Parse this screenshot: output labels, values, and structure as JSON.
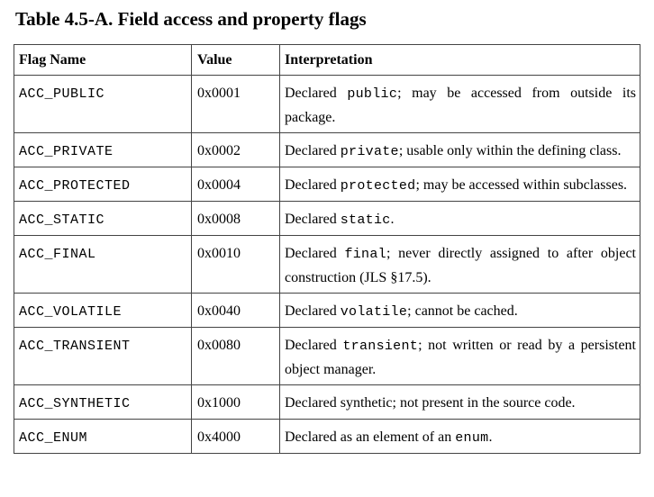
{
  "caption": "Table 4.5-A. Field access and property flags",
  "headers": {
    "name": "Flag Name",
    "value": "Value",
    "interpretation": "Interpretation"
  },
  "rows": [
    {
      "name": "ACC_PUBLIC",
      "value": "0x0001",
      "interp": {
        "pre": "Declared ",
        "code": "public",
        "post": "; may be accessed from outside its package."
      }
    },
    {
      "name": "ACC_PRIVATE",
      "value": "0x0002",
      "interp": {
        "pre": "Declared ",
        "code": "private",
        "post": "; usable only within the defining class."
      }
    },
    {
      "name": "ACC_PROTECTED",
      "value": "0x0004",
      "interp": {
        "pre": "Declared ",
        "code": "protected",
        "post": "; may be accessed within subclasses."
      }
    },
    {
      "name": "ACC_STATIC",
      "value": "0x0008",
      "interp": {
        "pre": "Declared ",
        "code": "static",
        "post": "."
      }
    },
    {
      "name": "ACC_FINAL",
      "value": "0x0010",
      "interp": {
        "pre": "Declared ",
        "code": "final",
        "post": "; never directly assigned to after object construction (JLS §17.5)."
      }
    },
    {
      "name": "ACC_VOLATILE",
      "value": "0x0040",
      "interp": {
        "pre": "Declared ",
        "code": "volatile",
        "post": "; cannot be cached."
      }
    },
    {
      "name": "ACC_TRANSIENT",
      "value": "0x0080",
      "interp": {
        "pre": "Declared ",
        "code": "transient",
        "post": "; not written or read by a persistent object manager."
      }
    },
    {
      "name": "ACC_SYNTHETIC",
      "value": "0x1000",
      "interp": {
        "pre": "Declared synthetic; not present in the source code.",
        "code": "",
        "post": ""
      }
    },
    {
      "name": "ACC_ENUM",
      "value": "0x4000",
      "interp": {
        "pre": "Declared as an element of an ",
        "code": "enum",
        "post": "."
      }
    }
  ]
}
